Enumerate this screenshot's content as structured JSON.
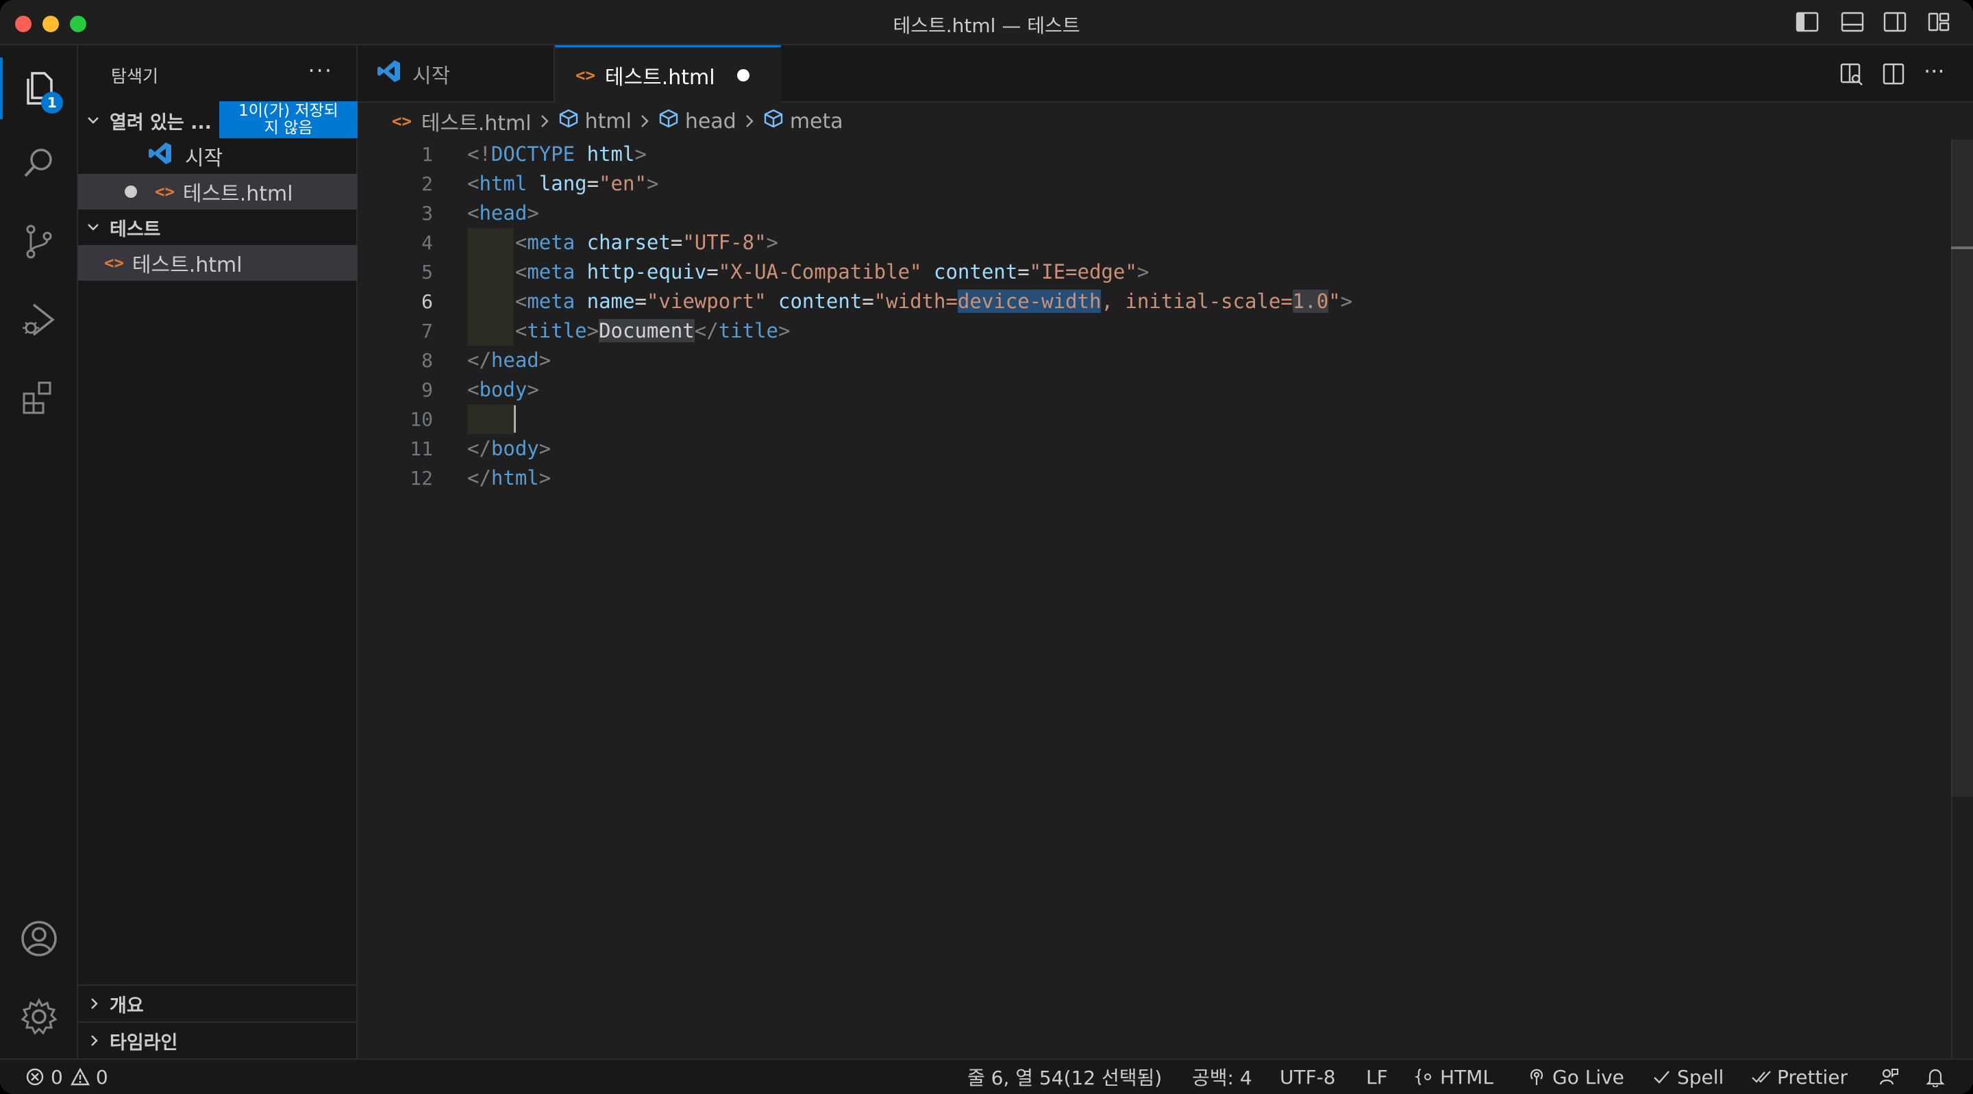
{
  "window": {
    "title": "테스트.html — 테스트"
  },
  "activity_bar": {
    "explorer_badge": "1"
  },
  "sidebar": {
    "header": "탐색기",
    "more": "···",
    "open_editors": {
      "label": "열려 있는 ...",
      "unsaved_badge_line1": "1이(가) 저장되",
      "unsaved_badge_line2": "지 않음",
      "items": [
        {
          "label": "시작"
        },
        {
          "label": "테스트.html"
        }
      ]
    },
    "folder": {
      "label": "테스트",
      "items": [
        {
          "label": "테스트.html"
        }
      ]
    },
    "outline_label": "개요",
    "timeline_label": "타임라인"
  },
  "tabs": [
    {
      "label": "시작"
    },
    {
      "label": "테스트.html"
    }
  ],
  "tab_actions_more": "···",
  "breadcrumb": [
    "테스트.html",
    "html",
    "head",
    "meta"
  ],
  "editor": {
    "line_numbers": [
      "1",
      "2",
      "3",
      "4",
      "5",
      "6",
      "7",
      "8",
      "9",
      "10",
      "11",
      "12"
    ],
    "current_line": 6
  },
  "statusbar": {
    "errors": "0",
    "warnings": "0",
    "position": "줄 6, 열 54(12 선택됨)",
    "indent": "공백: 4",
    "encoding": "UTF-8",
    "eol": "LF",
    "language": "HTML",
    "go_live": "Go Live",
    "spell": "Spell",
    "prettier": "Prettier"
  },
  "colors": {
    "accent": "#0078d4",
    "html_icon": "#e37933"
  }
}
